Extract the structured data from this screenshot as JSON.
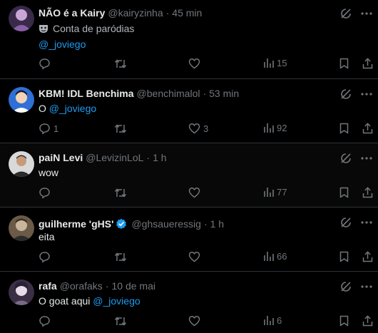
{
  "tweets": [
    {
      "name": "NÃO é a Kairy",
      "handle": "@kairyzinha",
      "time": "45 min",
      "parody_label": "Conta de paródias",
      "text_before": "",
      "mention": "@_joviego",
      "reply_count": "",
      "like_count": "",
      "view_count": "15",
      "avatar_colors": [
        "#3a2a4a",
        "#c9a6d8"
      ]
    },
    {
      "name": "KBM! IDL Benchima",
      "handle": "@benchimalol",
      "time": "53 min",
      "text_before": "O",
      "mention": "@_joviego",
      "reply_count": "1",
      "like_count": "3",
      "view_count": "92",
      "avatar_colors": [
        "#2f6fd6",
        "#f1d3b8"
      ]
    },
    {
      "name": "paiN Levi",
      "handle": "@LevizinLoL",
      "time": "1 h",
      "text": "wow",
      "reply_count": "",
      "like_count": "",
      "view_count": "77",
      "avatar_colors": [
        "#d9d9d9",
        "#2a2a2a"
      ]
    },
    {
      "name": "guilherme 'gHS'",
      "handle": "@ghsaueressig",
      "time": "1 h",
      "text": "eita",
      "reply_count": "",
      "like_count": "",
      "view_count": "66",
      "avatar_colors": [
        "#6b5a47",
        "#c9b79d"
      ]
    },
    {
      "name": "rafa",
      "handle": "@orafaks",
      "time": "10 de mai",
      "text_before": "O goat aqui",
      "mention": "@_joviego",
      "reply_count": "",
      "like_count": "",
      "view_count": "6",
      "avatar_colors": [
        "#3b2f45",
        "#e6dcea"
      ]
    }
  ],
  "colors": {
    "background": "#000000",
    "text": "#e7e9ea",
    "muted": "#71767b",
    "link": "#1d9bf0",
    "divider": "#2f3336",
    "verified": "#1d9bf0"
  },
  "icons": [
    "reply-icon",
    "retweet-icon",
    "like-icon",
    "views-icon",
    "bookmark-icon",
    "share-icon",
    "grok-icon",
    "more-icon",
    "verified-icon",
    "parody-mask-icon"
  ]
}
